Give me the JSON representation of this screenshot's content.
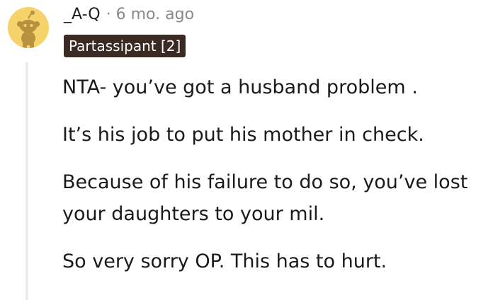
{
  "comment": {
    "author": "_A-Q",
    "separator": "·",
    "timestamp": "6 mo. ago",
    "flair": "Partassipant [2]",
    "avatar_icon": "snoo-avatar-icon",
    "paragraphs": [
      "NTA- you’ve got a husband problem .",
      "It’s his job to put his mother in check.",
      "Because of his failure to do so, you’ve lost your daughters to your mil.",
      "So very sorry OP. This has to hurt."
    ]
  },
  "colors": {
    "avatar_bg": "#f6d26a",
    "avatar_figure": "#b8913e",
    "flair_bg": "#3b2a21",
    "flair_text": "#ffffff",
    "meta_text": "#878a8c",
    "body_text": "#1a1a1b",
    "thread_line": "#eaeaea"
  }
}
